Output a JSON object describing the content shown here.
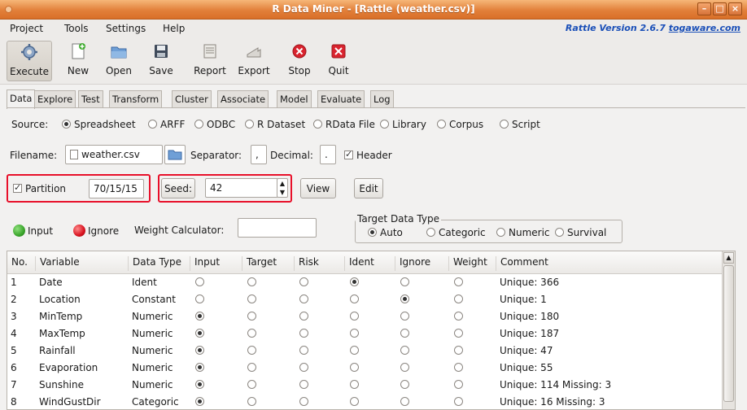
{
  "window": {
    "title": "R Data Miner - [Rattle (weather.csv)]"
  },
  "menu": [
    "Project",
    "Tools",
    "Settings",
    "Help"
  ],
  "version": {
    "prefix": "Rattle Version 2.6.7 ",
    "link": "togaware.com"
  },
  "toolbar": {
    "execute": "Execute",
    "new": "New",
    "open": "Open",
    "save": "Save",
    "report": "Report",
    "export": "Export",
    "stop": "Stop",
    "quit": "Quit"
  },
  "tabs": [
    "Data",
    "Explore",
    "Test",
    "Transform",
    "Cluster",
    "Associate",
    "Model",
    "Evaluate",
    "Log"
  ],
  "source": {
    "label": "Source:",
    "options": [
      "Spreadsheet",
      "ARFF",
      "ODBC",
      "R Dataset",
      "RData File",
      "Library",
      "Corpus",
      "Script"
    ],
    "selected": "Spreadsheet"
  },
  "file": {
    "filename_label": "Filename:",
    "filename": "weather.csv",
    "separator_label": "Separator:",
    "separator": ",",
    "decimal_label": "Decimal:",
    "decimal": ".",
    "header_label": "Header"
  },
  "partition": {
    "label": "Partition",
    "value": "70/15/15",
    "seed_button": "Seed:",
    "seed_value": "42",
    "view_button": "View",
    "edit_button": "Edit"
  },
  "roles": {
    "input_label": "Input",
    "ignore_label": "Ignore",
    "weight_label": "Weight Calculator:",
    "weight_value": ""
  },
  "target_type": {
    "label": "Target Data Type",
    "options": [
      "Auto",
      "Categoric",
      "Numeric",
      "Survival"
    ],
    "selected": "Auto"
  },
  "table": {
    "headers": [
      "No.",
      "Variable",
      "Data Type",
      "Input",
      "Target",
      "Risk",
      "Ident",
      "Ignore",
      "Weight",
      "Comment"
    ],
    "rows": [
      {
        "no": "1",
        "variable": "Date",
        "type": "Ident",
        "role": "Ident",
        "comment": "Unique: 366"
      },
      {
        "no": "2",
        "variable": "Location",
        "type": "Constant",
        "role": "Ignore",
        "comment": "Unique: 1"
      },
      {
        "no": "3",
        "variable": "MinTemp",
        "type": "Numeric",
        "role": "Input",
        "comment": "Unique: 180"
      },
      {
        "no": "4",
        "variable": "MaxTemp",
        "type": "Numeric",
        "role": "Input",
        "comment": "Unique: 187"
      },
      {
        "no": "5",
        "variable": "Rainfall",
        "type": "Numeric",
        "role": "Input",
        "comment": "Unique: 47"
      },
      {
        "no": "6",
        "variable": "Evaporation",
        "type": "Numeric",
        "role": "Input",
        "comment": "Unique: 55"
      },
      {
        "no": "7",
        "variable": "Sunshine",
        "type": "Numeric",
        "role": "Input",
        "comment": "Unique: 114 Missing: 3"
      },
      {
        "no": "8",
        "variable": "WindGustDir",
        "type": "Categoric",
        "role": "Input",
        "comment": "Unique: 16 Missing: 3"
      }
    ]
  },
  "colors": {
    "title_bar": "#e2803a",
    "highlight": "#e8102a",
    "input_dot": "#3aa52b",
    "ignore_dot": "#d8121f",
    "version_link": "#1a4fb8"
  }
}
